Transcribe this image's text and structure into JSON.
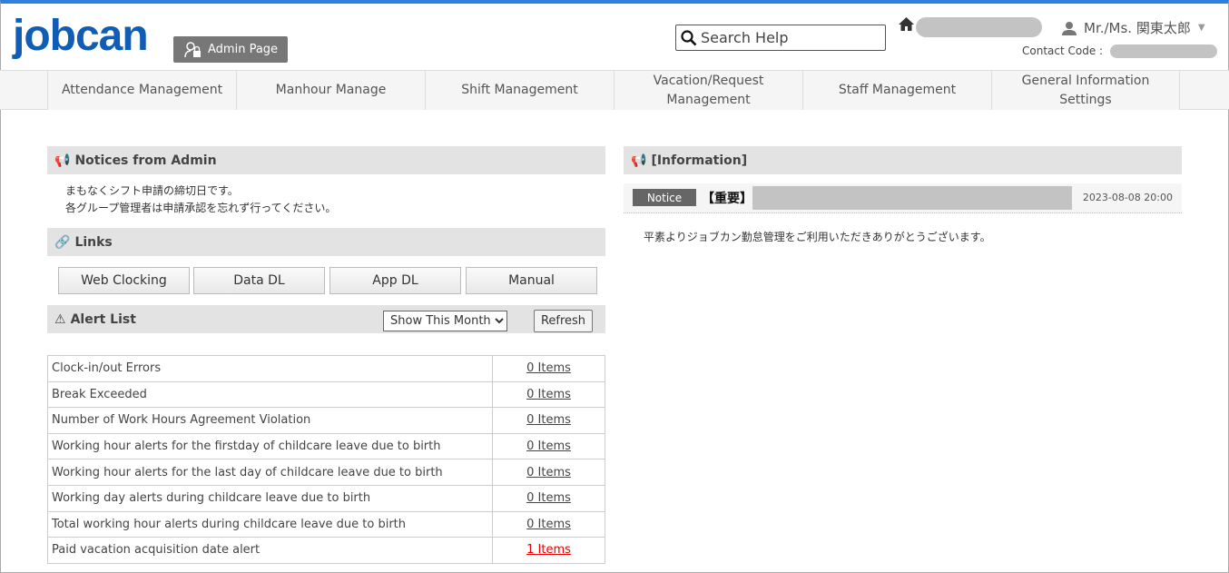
{
  "header": {
    "logo": "jobcan",
    "admin_button": "Admin Page",
    "search_placeholder": "Search Help",
    "user_name": "Mr./Ms. 関東太郎",
    "contact_label": "Contact Code :"
  },
  "nav": [
    {
      "label": "Attendance Management"
    },
    {
      "label": "Manhour Manage"
    },
    {
      "label": "Shift Management"
    },
    {
      "label": "Vacation/Request Management"
    },
    {
      "label": "Staff Management"
    },
    {
      "label": "General Information Settings"
    }
  ],
  "notices": {
    "title": "Notices from Admin",
    "lines": [
      "まもなくシフト申請の締切日です。",
      "各グループ管理者は申請承認を忘れず行ってください。"
    ]
  },
  "links": {
    "title": "Links",
    "buttons": [
      "Web Clocking",
      "Data DL",
      "App DL",
      "Manual"
    ]
  },
  "alerts": {
    "title": "Alert List",
    "period": "Show This Month",
    "refresh": "Refresh",
    "rows": [
      {
        "label": "Clock-in/out Errors",
        "value": "0 Items"
      },
      {
        "label": "Break Exceeded",
        "value": "0 Items"
      },
      {
        "label": "Number of Work Hours Agreement Violation",
        "value": "0 Items"
      },
      {
        "label": "Working hour alerts for the firstday of childcare leave due to birth",
        "value": "0 Items"
      },
      {
        "label": "Working hour alerts for the last day of childcare leave due to birth",
        "value": "0 Items"
      },
      {
        "label": "Working day alerts during childcare leave due to birth",
        "value": "0 Items"
      },
      {
        "label": "Total working hour alerts during childcare leave due to birth",
        "value": "0 Items"
      },
      {
        "label": "Paid vacation acquisition date alert",
        "value": "1 Items",
        "highlight": "#e00000"
      }
    ]
  },
  "information": {
    "title": "[Information]",
    "badge": "Notice",
    "tag": "【重要】",
    "date": "2023-08-08 20:00",
    "body": "平素よりジョブカン勤怠管理をご利用いただきありがとうございます。"
  },
  "colors": {
    "brand": "#0f5db5",
    "top_bar": "#2f7fe0",
    "alert_red": "#e00000"
  }
}
